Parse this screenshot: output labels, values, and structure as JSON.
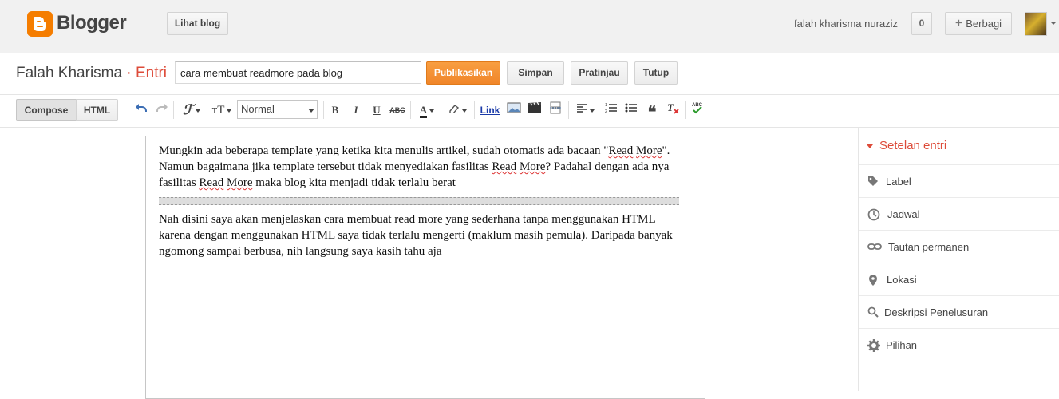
{
  "app": {
    "brand": "Blogger",
    "brand_color": "#f57d00"
  },
  "header": {
    "view_blog_label": "Lihat blog",
    "username": "falah kharisma nuraziz",
    "notification_count": "0",
    "share_label": "Berbagi"
  },
  "post_bar": {
    "blog_name": "Falah Kharisma",
    "separator": " · ",
    "section": "Entri",
    "title_value": "cara membuat readmore pada blog",
    "publish_label": "Publikasikan",
    "save_label": "Simpan",
    "preview_label": "Pratinjau",
    "close_label": "Tutup"
  },
  "toolbar": {
    "compose_label": "Compose",
    "html_label": "HTML",
    "font_size_value": "Normal",
    "link_label": "Link"
  },
  "editor": {
    "para1_a": "Mungkin ada beberapa template yang ketika kita menulis artikel, sudah otomatis ada bacaan \"",
    "para1_read": "Read",
    "para1_more": "More",
    "para1_b": "\". Namun bagaimana jika template tersebut tidak menyediakan fasilitas ",
    "para1_read2": "Read",
    "para1_more2": "More",
    "para1_c": "? Padahal dengan ada nya fasilitas ",
    "para1_read3": "Read",
    "para1_more3": "More",
    "para1_d": " maka blog kita menjadi tidak terlalu berat",
    "para2": " Nah disini saya akan menjelaskan cara membuat read more yang sederhana tanpa menggunakan HTML karena dengan menggunakan HTML saya tidak terlalu mengerti (maklum masih pemula). Daripada banyak ngomong sampai berbusa, nih langsung saya kasih tahu aja"
  },
  "sidebar": {
    "heading": "Setelan entri",
    "items": [
      {
        "label": "Label",
        "icon": "tag-icon"
      },
      {
        "label": "Jadwal",
        "icon": "clock-icon"
      },
      {
        "label": "Tautan permanen",
        "icon": "link-icon"
      },
      {
        "label": "Lokasi",
        "icon": "location-pin-icon"
      },
      {
        "label": "Deskripsi Penelusuran",
        "icon": "search-icon"
      },
      {
        "label": "Pilihan",
        "icon": "gear-icon"
      }
    ]
  }
}
